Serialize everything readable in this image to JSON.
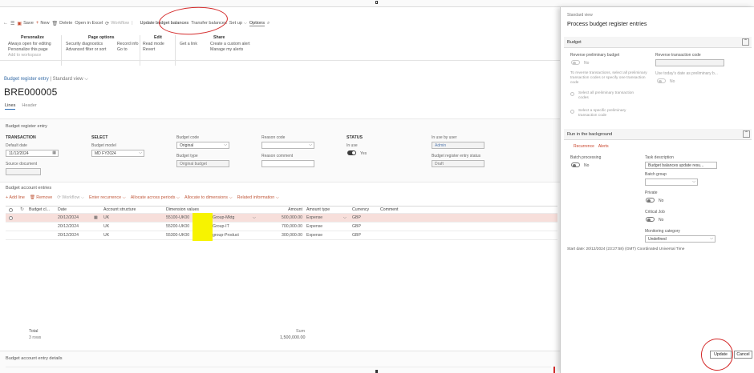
{
  "action_pane": {
    "save": "Save",
    "new": "New",
    "delete": "Delete",
    "open_in_excel": "Open in Excel",
    "workflow": "Workflow",
    "update_budget_balances": "Update budget balances",
    "transfer_balances": "Transfer balances",
    "set_up": "Set up",
    "options": "Options"
  },
  "ribbon_groups": [
    {
      "title": "Personalize",
      "items": [
        "Always open for editing",
        "Personalize this page",
        "Add to workspace"
      ]
    },
    {
      "title": "Page options",
      "items": [
        "Security diagnostics",
        "Advanced filter or sort"
      ]
    },
    {
      "title": "",
      "items": [
        "Record info",
        "Go to"
      ]
    },
    {
      "title": "Edit",
      "items": [
        "Read mode",
        "Revert"
      ]
    },
    {
      "title": "Share",
      "items": [
        "Get a link"
      ]
    },
    {
      "title": "",
      "items": [
        "Create a custom alert",
        "Manage my alerts"
      ]
    }
  ],
  "page": {
    "breadcrumb": "Budget register entry",
    "view": "Standard view",
    "record_id": "BRE000005",
    "tabs": [
      "Lines",
      "Header"
    ]
  },
  "budget_register_entry": {
    "title": "Budget register entry",
    "transaction_cap": "TRANSACTION",
    "default_date_label": "Default date",
    "default_date": "11/12/2024",
    "source_document_label": "Source document",
    "select_cap": "SELECT",
    "budget_model_label": "Budget model",
    "budget_model": "MD FY2024",
    "budget_code_label": "Budget code",
    "budget_code": "Original",
    "budget_type_label": "Budget type",
    "budget_type": "Original budget",
    "reason_code_label": "Reason code",
    "reason_comment_label": "Reason comment",
    "status_cap": "STATUS",
    "in_use_label": "In use",
    "in_use_value": "Yes",
    "in_use_by_user_label": "In use by user",
    "in_use_by_user": "Admin",
    "entry_status_label": "Budget register entry status",
    "entry_status": "Draft"
  },
  "budget_account_entries": {
    "title": "Budget account entries",
    "toolbar": [
      "+ Add line",
      "Remove",
      "Workflow",
      "Enter recurrence",
      "Allocate across periods",
      "Allocate to dimensions",
      "Related information"
    ],
    "columns": [
      "Budget cl...",
      "Date",
      "Account structure",
      "Dimension values",
      "Amount",
      "Amount type",
      "Currency",
      "Comment"
    ],
    "rows": [
      {
        "date": "20/12/2024",
        "structure": "UK",
        "dim_prefix": "55100-UK00",
        "dim_suffix": "Group-Mktg",
        "amount": "500,000.00",
        "type": "Expense",
        "currency": "GBP"
      },
      {
        "date": "20/12/2024",
        "structure": "UK",
        "dim_prefix": "55200-UK00",
        "dim_suffix": "Group-IT",
        "amount": "700,000.00",
        "type": "Expense",
        "currency": "GBP"
      },
      {
        "date": "20/12/2024",
        "structure": "UK",
        "dim_prefix": "55300-UK00",
        "dim_suffix": "group-Product",
        "amount": "300,000.00",
        "type": "Expense",
        "currency": "GBP"
      }
    ],
    "total_label": "Total",
    "rows_count": "3 rows",
    "sum_label": "Sum",
    "sum_value": "1,500,000.00"
  },
  "details_title": "Budget account entry details",
  "panel": {
    "view": "Standard view",
    "title": "Process budget register entries",
    "budget_section": "Budget",
    "reverse_preliminary_label": "Reverse preliminary budget",
    "reverse_preliminary_value": "No",
    "reverse_transaction_code_label": "Reverse transaction code",
    "reverse_note": "To reverse transactions, select all preliminary transaction codes or specify one transaction code",
    "use_todays_date_label": "Use today's date as preliminary b...",
    "use_todays_date_value": "No",
    "select_all_option": "Select all preliminary transaction codes",
    "select_specific_option": "Select a specific preliminary transaction code",
    "background_section": "Run in the background",
    "subtabs": [
      "Recurrence",
      "Alerts"
    ],
    "batch_processing_label": "Batch processing",
    "batch_processing_value": "No",
    "task_description_label": "Task description",
    "task_description": "Budget balances update resu...",
    "batch_group_label": "Batch group",
    "private_label": "Private",
    "private_value": "No",
    "critical_job_label": "Critical Job",
    "critical_job_value": "No",
    "monitoring_category_label": "Monitoring category",
    "monitoring_category": "Undefined",
    "start_date_note": "Start date: 20/12/2024 (23:27:58) (GMT) Coordinated Universal Time",
    "update_button": "Update",
    "cancel_button": "Cancel"
  }
}
